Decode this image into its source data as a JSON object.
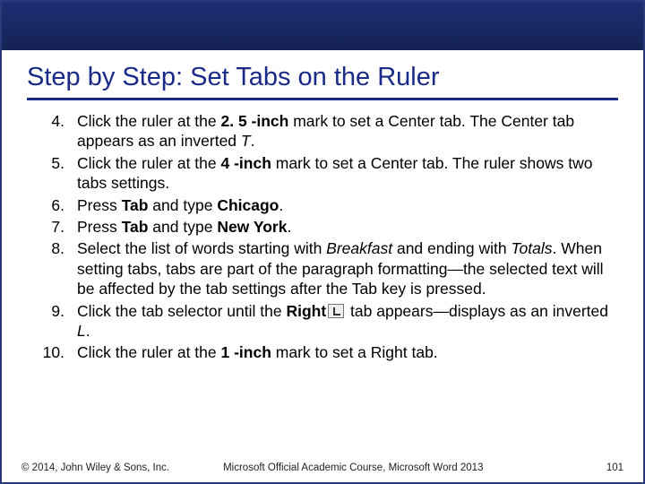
{
  "title": "Step by Step: Set Tabs on the Ruler",
  "steps": [
    {
      "n": "4.",
      "parts": [
        {
          "t": "Click the ruler at the "
        },
        {
          "t": "2. 5 -inch",
          "b": true
        },
        {
          "t": " mark to set a Center tab. The Center tab appears as an inverted "
        },
        {
          "t": "T",
          "i": true
        },
        {
          "t": "."
        }
      ]
    },
    {
      "n": "5.",
      "parts": [
        {
          "t": "Click the ruler at the "
        },
        {
          "t": "4 -inch",
          "b": true
        },
        {
          "t": " mark to set a Center tab. The ruler shows two tabs settings."
        }
      ]
    },
    {
      "n": "6.",
      "parts": [
        {
          "t": "Press "
        },
        {
          "t": "Tab",
          "b": true
        },
        {
          "t": " and type "
        },
        {
          "t": "Chicago",
          "b": true
        },
        {
          "t": "."
        }
      ]
    },
    {
      "n": "7.",
      "parts": [
        {
          "t": "Press "
        },
        {
          "t": "Tab",
          "b": true
        },
        {
          "t": " and type "
        },
        {
          "t": "New York",
          "b": true
        },
        {
          "t": "."
        }
      ]
    },
    {
      "n": "8.",
      "parts": [
        {
          "t": "Select the list of words starting with "
        },
        {
          "t": "Breakfast",
          "i": true
        },
        {
          "t": " and ending with "
        },
        {
          "t": "Totals",
          "i": true
        },
        {
          "t": ". When setting tabs, tabs are part of the paragraph formatting—the selected text will be affected by the tab settings after the Tab key is pressed."
        }
      ]
    },
    {
      "n": "9.",
      "parts": [
        {
          "t": "Click the tab selector until the "
        },
        {
          "t": "Right",
          "b": true
        },
        {
          "icon": "right-tab-icon"
        },
        {
          "t": " tab appears—displays as an inverted "
        },
        {
          "t": "L",
          "i": true
        },
        {
          "t": "."
        }
      ]
    },
    {
      "n": "10.",
      "parts": [
        {
          "t": "Click the ruler at the "
        },
        {
          "t": "1 -inch",
          "b": true
        },
        {
          "t": " mark to set a Right tab."
        }
      ]
    }
  ],
  "footer": {
    "copyright": "© 2014, John Wiley & Sons, Inc.",
    "course": "Microsoft Official Academic Course, Microsoft Word 2013",
    "page": "101"
  }
}
